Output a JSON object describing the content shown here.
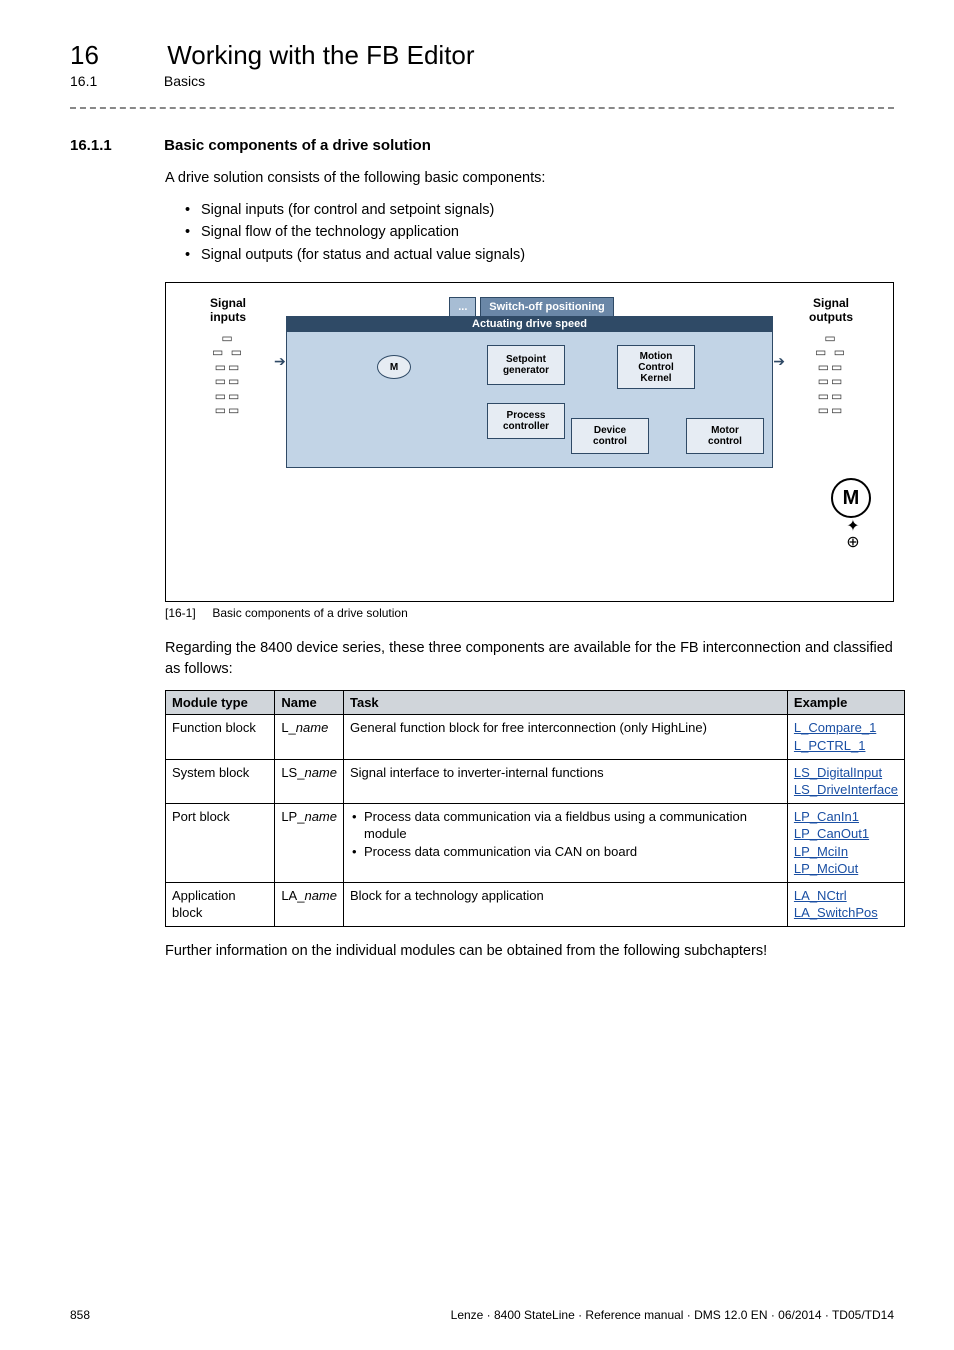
{
  "chapter": {
    "number": "16",
    "title": "Working with the FB Editor"
  },
  "subsection_header": {
    "number": "16.1",
    "title": "Basics"
  },
  "section": {
    "number": "16.1.1",
    "title": "Basic components of a drive solution"
  },
  "intro": "A drive solution consists of the following basic components:",
  "bullets": [
    "Signal inputs (for control and setpoint signals)",
    "Signal flow of the technology application",
    "Signal outputs (for status and actual value signals)"
  ],
  "diagram": {
    "inputs_label": "Signal\ninputs",
    "outputs_label": "Signal\noutputs",
    "tabs": {
      "ellipsis": "...",
      "switch_off": "Switch-off positioning"
    },
    "panel_title": "Actuating drive speed",
    "blocks": {
      "m_small": "M",
      "setpoint": "Setpoint\ngenerator",
      "motion": "Motion\nControl\nKernel",
      "process": "Process\ncontroller",
      "device": "Device\ncontrol",
      "motor": "Motor\ncontrol"
    },
    "big_m": "M"
  },
  "caption": {
    "tag": "[16-1]",
    "text": "Basic components of a drive solution"
  },
  "para_after_fig": "Regarding the 8400 device series, these three components are available for the FB interconnection and classified as follows:",
  "table": {
    "headers": {
      "module_type": "Module type",
      "name": "Name",
      "task": "Task",
      "example": "Example"
    },
    "rows": [
      {
        "module_type": "Function block",
        "name_prefix": "L_",
        "name_italic": "name",
        "task_text": "General function block for free interconnection (only HighLine)",
        "examples": [
          "L_Compare_1",
          "L_PCTRL_1"
        ]
      },
      {
        "module_type": "System block",
        "name_prefix": "LS_",
        "name_italic": "name",
        "task_text": "Signal interface to inverter-internal functions",
        "examples": [
          "LS_DigitalInput",
          "LS_DriveInterface"
        ]
      },
      {
        "module_type": "Port block",
        "name_prefix": "LP_",
        "name_italic": "name",
        "task_bullets": [
          "Process data communication via a fieldbus using a communication module",
          "Process data communication via CAN on board"
        ],
        "examples": [
          "LP_CanIn1",
          "LP_CanOut1",
          "LP_MciIn",
          "LP_MciOut"
        ]
      },
      {
        "module_type": "Application block",
        "name_prefix": "LA_",
        "name_italic": "name",
        "task_text": "Block for a technology application",
        "examples": [
          "LA_NCtrl",
          "LA_SwitchPos"
        ]
      }
    ]
  },
  "para_after_table": "Further information on the individual modules can be obtained from the following subchapters!",
  "footer": {
    "page": "858",
    "product": "Lenze · 8400 StateLine · Reference manual · DMS 12.0 EN · 06/2014 · TD05/TD14"
  }
}
